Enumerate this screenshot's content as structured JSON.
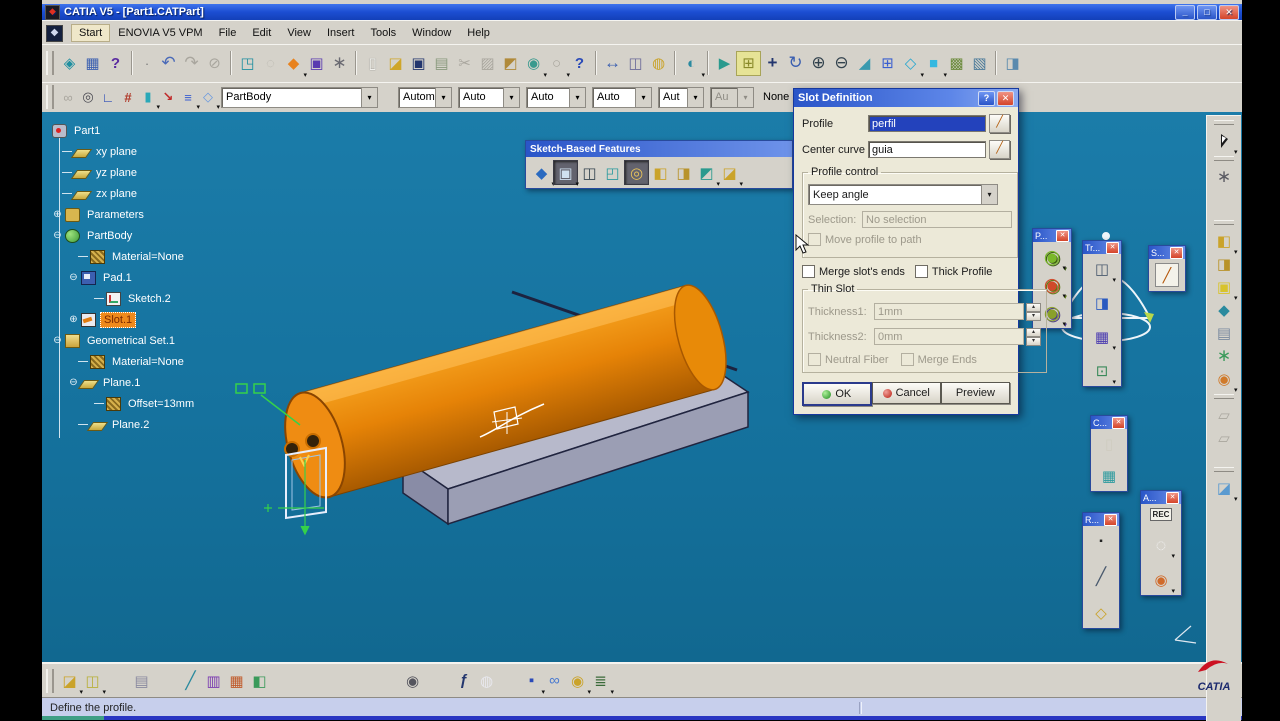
{
  "window": {
    "title": "CATIA V5 - [Part1.CATPart]"
  },
  "menu": {
    "items": [
      "Start",
      "ENOVIA V5 VPM",
      "File",
      "Edit",
      "View",
      "Insert",
      "Tools",
      "Window",
      "Help"
    ]
  },
  "icons": {
    "app_logo": "◆",
    "min": "_",
    "max": "□",
    "close": "✕",
    "help_q": "?",
    "wb1": "◈",
    "wb2": "▦",
    "wb3": "?",
    "u_dot": "·",
    "undo": "↶",
    "redo": "↷",
    "erase": "⊘",
    "vcube": "◳",
    "ghost": "◌",
    "ptool": "◆",
    "pwin": "▣",
    "pexp": "∗",
    "new": "▯",
    "open": "◪",
    "save": "▣",
    "print": "▤",
    "cut": "✂",
    "copy": "▨",
    "paste": "◩",
    "snap": "◉",
    "ring": "○",
    "whats": "?",
    "meas1": "↔",
    "meas2": "◫",
    "mass": "◍",
    "swatch": "◐",
    "fly": "▶",
    "fit": "⊞",
    "pan": "+",
    "rot": "↻",
    "zin": "⊕",
    "zout": "⊖",
    "nview": "◢",
    "mview": "⊞",
    "iso": "◇",
    "shade": "■",
    "hline": "▩",
    "rend": "▧",
    "rend2": "◨",
    "r2a": "∞",
    "r2b": "◎",
    "r2c": "∟",
    "r2d": "#",
    "r2e": "▮",
    "r2f": "↘",
    "r2g": "≡",
    "r2h": "◇",
    "dd": "▾",
    "spin_up": "▴",
    "spin_dn": "▾",
    "sbf1": "◆",
    "sbf2": "▣",
    "sbf3": "◫",
    "sbf4": "◰",
    "sbf5": "◎",
    "sbf6": "◧",
    "sbf7": "◨",
    "sbf8": "◩",
    "sbf9": "◪",
    "pal_p1": "◉",
    "pal_p2": "◉",
    "pal_p3": "◉",
    "pal_t1": "◫",
    "pal_t2": "◨",
    "pal_t3": "▦",
    "pal_t4": "⊡",
    "pal_s1": "╱",
    "pal_c1": "▯",
    "pal_c2": "▦",
    "pal_r1": "▪",
    "pal_r2": "╱",
    "pal_r3": "◇",
    "pal_a2": "◌",
    "pal_a3": "◉",
    "d1": "∗",
    "d2": "◧",
    "d3": "◨",
    "d4": "▣",
    "d5": "◆",
    "d6": "▤",
    "d7": "∗",
    "d8": "◉",
    "d9": "▱",
    "d10": "▱",
    "d11": "◪",
    "b1": "◪",
    "b2": "◫",
    "b3": "▤",
    "b4": "╱",
    "b5": "▥",
    "b6": "▦",
    "b7": "◧",
    "b8": "◉",
    "b9": "ƒ",
    "b10": "◍",
    "b11": "▪",
    "b12": "∞",
    "b13": "◉",
    "b14": "≣"
  },
  "workbench_bar": {
    "tool_combo": "PartBody",
    "combo1": "Autom",
    "combo2": "Auto",
    "combo3": "Auto",
    "combo4": "Auto",
    "combo5": "Aut",
    "combo6": "Au",
    "none_label": "None"
  },
  "sketch_toolbar": {
    "title": "Sketch-Based Features"
  },
  "tree": {
    "items": [
      {
        "label": "Part1",
        "exp": null
      },
      {
        "label": "xy plane",
        "exp": null
      },
      {
        "label": "yz plane",
        "exp": null
      },
      {
        "label": "zx plane",
        "exp": null
      },
      {
        "label": "Parameters",
        "exp": "⊕"
      },
      {
        "label": "PartBody",
        "exp": "⊖"
      },
      {
        "label": "Material=None",
        "exp": null
      },
      {
        "label": "Pad.1",
        "exp": "⊖"
      },
      {
        "label": "Sketch.2",
        "exp": null
      },
      {
        "label": "Slot.1",
        "exp": "⊕"
      },
      {
        "label": "Geometrical Set.1",
        "exp": "⊖"
      },
      {
        "label": "Material=None",
        "exp": null
      },
      {
        "label": "Plane.1",
        "exp": "⊖"
      },
      {
        "label": "Offset=13mm",
        "exp": null
      },
      {
        "label": "Plane.2",
        "exp": null
      }
    ]
  },
  "dialog": {
    "title": "Slot Definition",
    "profile_label": "Profile",
    "profile_value": "perfil",
    "center_curve_label": "Center curve",
    "center_curve_value": "guia",
    "profile_control_legend": "Profile control",
    "keep_angle_value": "Keep angle",
    "selection_label": "Selection:",
    "selection_value": "No selection",
    "move_profile_label": "Move profile to path",
    "merge_slots_label": "Merge slot's ends",
    "thick_profile_label": "Thick Profile",
    "thin_slot_legend": "Thin Slot",
    "thickness1_label": "Thickness1:",
    "thickness1_value": "1mm",
    "thickness2_label": "Thickness2:",
    "thickness2_value": "0mm",
    "neutral_fiber_label": "Neutral Fiber",
    "merge_ends_label": "Merge Ends",
    "ok_label": "OK",
    "cancel_label": "Cancel",
    "preview_label": "Preview"
  },
  "palettes": {
    "p_title": "P...",
    "tr_title": "Tr...",
    "s_title": "S...",
    "c_title": "C...",
    "r_title": "R...",
    "a_title": "A...",
    "rec_label": "REC",
    "close_glyph": "✕"
  },
  "status": {
    "message": "Define the profile."
  },
  "branding": {
    "logo_text": "CATIA"
  }
}
